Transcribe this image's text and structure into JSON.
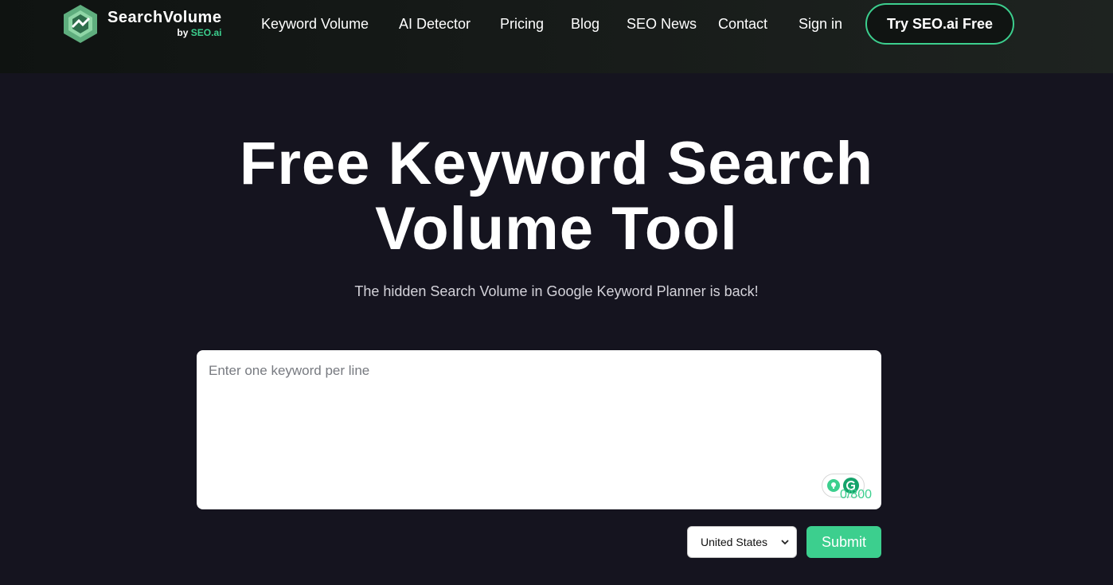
{
  "header": {
    "logo_title": "SearchVolume",
    "logo_by": "by",
    "logo_brand": "SEO.ai",
    "nav": [
      {
        "label": "Keyword Volume"
      },
      {
        "label": "AI Detector"
      },
      {
        "label": "Pricing"
      },
      {
        "label": "Blog"
      },
      {
        "label": "SEO News"
      },
      {
        "label": "Contact"
      },
      {
        "label": "Sign in"
      }
    ],
    "cta_label": "Try SEO.ai Free"
  },
  "hero": {
    "title_line1": "Free Keyword Search",
    "title_line2": "Volume Tool",
    "subtitle": "The hidden Search Volume in Google Keyword Planner is back!"
  },
  "form": {
    "keywords_placeholder": "Enter one keyword per line",
    "keywords_value": "",
    "counter": "0/800",
    "country_selected": "United States",
    "submit_label": "Submit",
    "grammarly_icons": [
      "lightbulb-icon",
      "grammarly-icon"
    ]
  },
  "colors": {
    "accent": "#3ccf8e",
    "background": "#15141f",
    "header_bg": "#161a18"
  }
}
